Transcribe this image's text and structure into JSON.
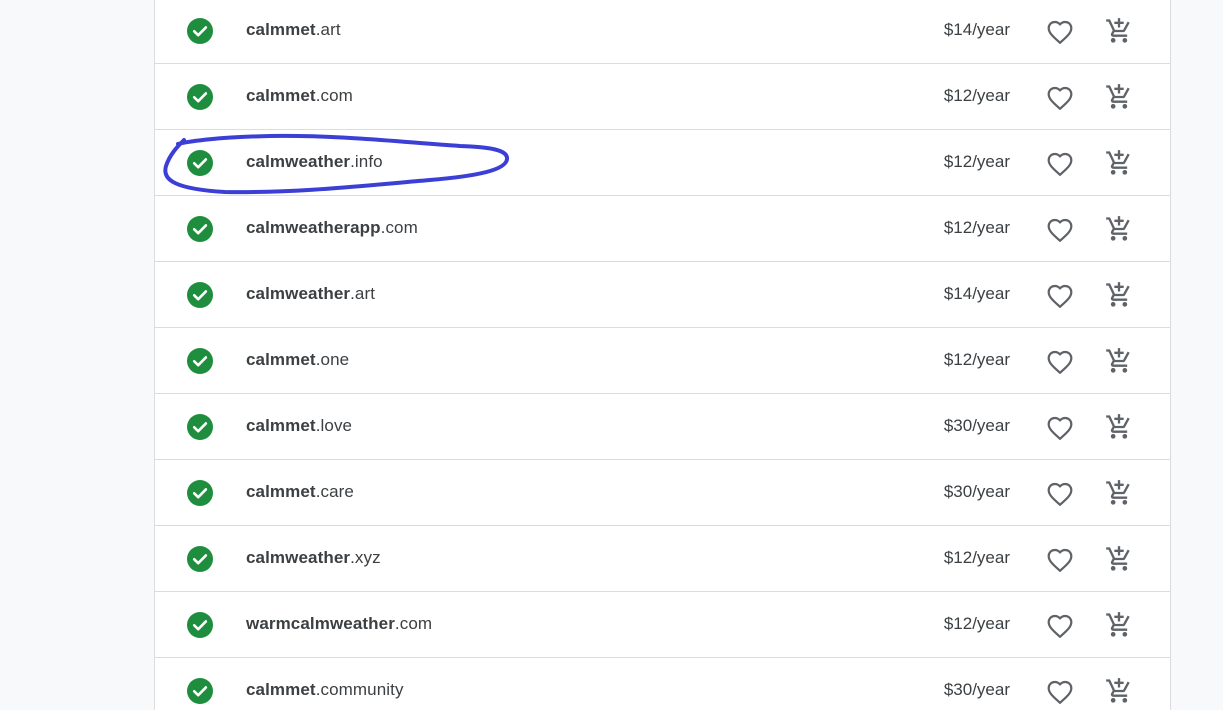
{
  "colors": {
    "available_green": "#1e8e3e",
    "text": "#3c4043",
    "icon_gray": "#5f6368",
    "annotation_blue": "#3c3fd6"
  },
  "row_icons": {
    "status": "check-circle-icon",
    "favorite": "heart-outline-icon",
    "cart": "add-shopping-cart-icon"
  },
  "results": [
    {
      "sld": "calmmet",
      "tld": ".art",
      "price": "$14/year"
    },
    {
      "sld": "calmmet",
      "tld": ".com",
      "price": "$12/year"
    },
    {
      "sld": "calmweather",
      "tld": ".info",
      "price": "$12/year",
      "highlighted": true
    },
    {
      "sld": "calmweatherapp",
      "tld": ".com",
      "price": "$12/year"
    },
    {
      "sld": "calmweather",
      "tld": ".art",
      "price": "$14/year"
    },
    {
      "sld": "calmmet",
      "tld": ".one",
      "price": "$12/year"
    },
    {
      "sld": "calmmet",
      "tld": ".love",
      "price": "$30/year"
    },
    {
      "sld": "calmmet",
      "tld": ".care",
      "price": "$30/year"
    },
    {
      "sld": "calmweather",
      "tld": ".xyz",
      "price": "$12/year"
    },
    {
      "sld": "warmcalmweather",
      "tld": ".com",
      "price": "$12/year"
    },
    {
      "sld": "calmmet",
      "tld": ".community",
      "price": "$30/year"
    }
  ]
}
